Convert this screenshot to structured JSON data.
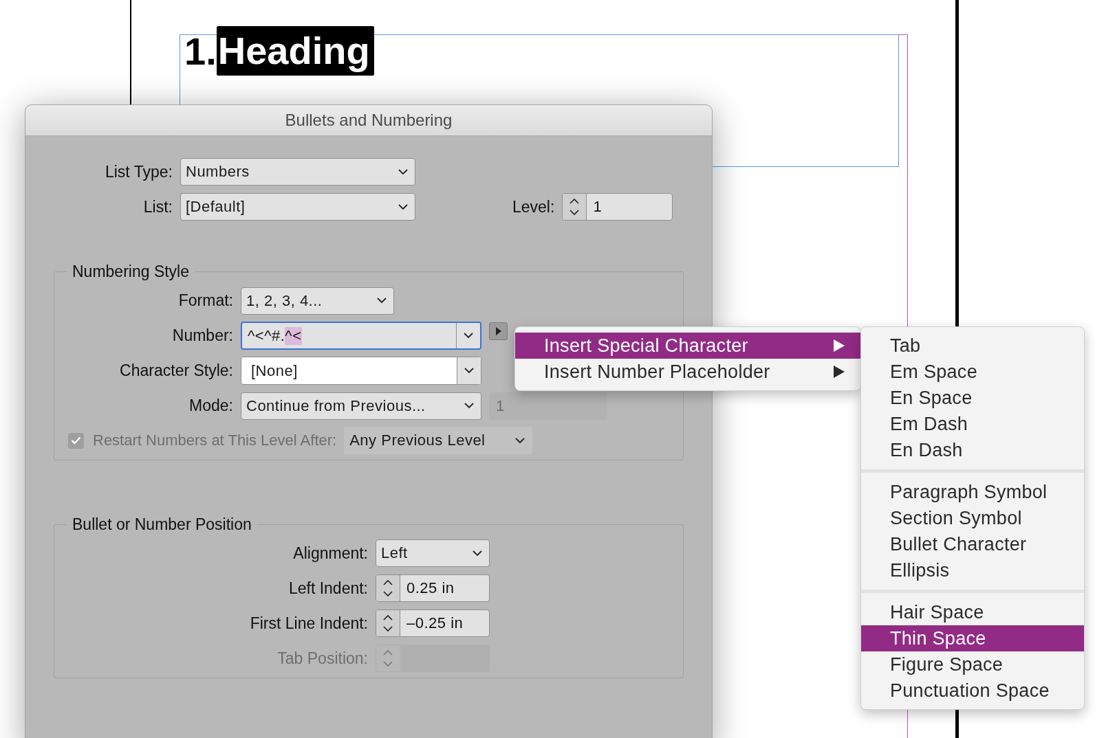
{
  "document": {
    "number": "1.",
    "heading": "Heading",
    "heading_selected": true
  },
  "dialog": {
    "title": "Bullets and Numbering",
    "list_type": {
      "label": "List Type:",
      "value": "Numbers"
    },
    "list": {
      "label": "List:",
      "value": "[Default]"
    },
    "level": {
      "label": "Level:",
      "value": "1"
    },
    "numbering_style": {
      "title": "Numbering Style",
      "fields": [
        {
          "label": "Format:",
          "kind": "dropdown",
          "value": "1, 2, 3, 4..."
        },
        {
          "label": "Number:",
          "kind": "combo",
          "value": "^<^#.",
          "selected_text": "^<",
          "focused": true,
          "menu_button": true
        },
        {
          "label": "Character Style:",
          "kind": "combo",
          "value": "[None]",
          "focused": false
        },
        {
          "label": "Mode:",
          "kind": "dropdown",
          "value": "Continue from Previous...",
          "start_at": {
            "value": "1",
            "disabled": true
          }
        }
      ],
      "restart": {
        "label": "Restart Numbers at This Level After:",
        "checked": true,
        "disabled": true,
        "value": "Any Previous Level"
      }
    },
    "position": {
      "title": "Bullet or Number Position",
      "fields": [
        {
          "label": "Alignment:",
          "kind": "dropdown",
          "value": "Left",
          "disabled": false
        },
        {
          "label": "Left Indent:",
          "kind": "spinner",
          "value": "0.25 in",
          "disabled": false
        },
        {
          "label": "First Line Indent:",
          "kind": "spinner",
          "value": "–0.25 in",
          "disabled": false
        },
        {
          "label": "Tab Position:",
          "kind": "spinner",
          "disabled": true
        }
      ]
    }
  },
  "menu": {
    "items": [
      {
        "label": "Insert Special Character",
        "selected": true,
        "has_submenu": true
      },
      {
        "label": "Insert Number Placeholder",
        "selected": false,
        "has_submenu": true
      }
    ]
  },
  "submenu": {
    "groups": [
      {
        "items": [
          {
            "label": "Tab",
            "selected": false
          },
          {
            "label": "Em Space",
            "selected": false
          },
          {
            "label": "En Space",
            "selected": false
          },
          {
            "label": "Em Dash",
            "selected": false
          },
          {
            "label": "En Dash",
            "selected": false
          }
        ]
      },
      {
        "items": [
          {
            "label": "Paragraph Symbol",
            "selected": false
          },
          {
            "label": "Section Symbol",
            "selected": false
          },
          {
            "label": "Bullet Character",
            "selected": false
          },
          {
            "label": "Ellipsis",
            "selected": false
          }
        ]
      },
      {
        "items": [
          {
            "label": "Hair Space",
            "selected": false
          },
          {
            "label": "Thin Space",
            "selected": true
          },
          {
            "label": "Figure Space",
            "selected": false
          },
          {
            "label": "Punctuation Space",
            "selected": false
          }
        ]
      }
    ]
  }
}
